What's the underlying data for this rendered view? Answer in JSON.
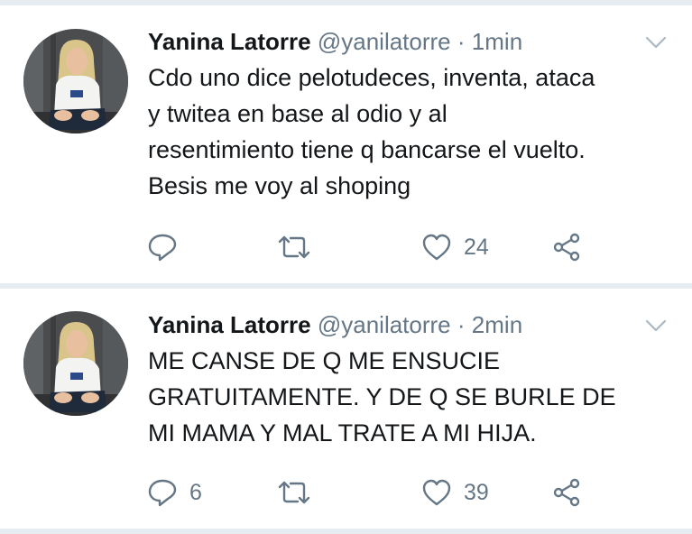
{
  "colors": {
    "text": "#14171a",
    "secondary": "#657786",
    "divider": "#e6ecf0",
    "background": "#ffffff"
  },
  "tweets": [
    {
      "author": {
        "name": "Yanina Latorre",
        "handle": "@yanilatorre",
        "avatar_icon": "avatar-photo"
      },
      "separator": "·",
      "time": "1min",
      "text_lines": [
        "Cdo uno dice pelotudeces, inventa, ataca",
        "y twitea en base al odio y al",
        "resentimiento tiene q bancarse el vuelto.",
        "Besis me voy al shoping"
      ],
      "actions": {
        "reply": {
          "icon": "reply-icon",
          "count": ""
        },
        "retweet": {
          "icon": "retweet-icon",
          "count": ""
        },
        "like": {
          "icon": "heart-icon",
          "count": "24"
        },
        "share": {
          "icon": "share-icon"
        }
      }
    },
    {
      "author": {
        "name": "Yanina Latorre",
        "handle": "@yanilatorre",
        "avatar_icon": "avatar-photo"
      },
      "separator": "·",
      "time": "2min",
      "text_lines": [
        "ME CANSE DE Q ME ENSUCIE",
        "GRATUITAMENTE. Y DE Q SE BURLE DE",
        "MI MAMA Y MAL TRATE A MI HIJA."
      ],
      "actions": {
        "reply": {
          "icon": "reply-icon",
          "count": "6"
        },
        "retweet": {
          "icon": "retweet-icon",
          "count": ""
        },
        "like": {
          "icon": "heart-icon",
          "count": "39"
        },
        "share": {
          "icon": "share-icon"
        }
      }
    }
  ]
}
